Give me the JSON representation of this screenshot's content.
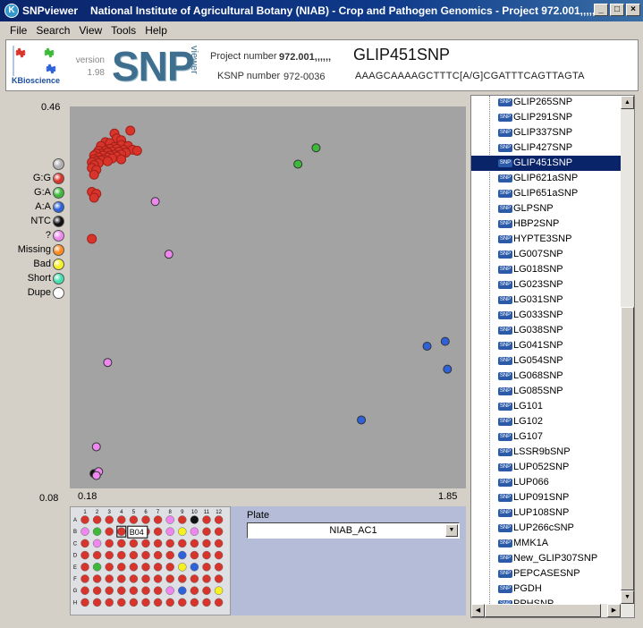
{
  "window": {
    "app_name": "SNPviewer",
    "title": "National Institute of Agricultural Botany (NIAB) - Crop and Pathogen Genomics - Project 972.001,,,,,,"
  },
  "menu": [
    "File",
    "Search",
    "View",
    "Tools",
    "Help"
  ],
  "header": {
    "logo_text": "KBioscience",
    "version_label": "version",
    "version_value": "1.98",
    "brand_big": "SNP",
    "brand_small": "viewer",
    "project_label": "Project number",
    "project_value": "972.001,,,,,,",
    "ksnp_label": "KSNP number",
    "ksnp_value": "972-0036",
    "snp_name": "GLIP451SNP",
    "sequence": "AAAGCAAAAGCTTTC[A/G]CGATTTCAGTTAGTA"
  },
  "legend": [
    {
      "label": "",
      "color": "#b0b0b0"
    },
    {
      "label": "G:G",
      "color": "#d9342b"
    },
    {
      "label": "G:A",
      "color": "#3db83a"
    },
    {
      "label": "A:A",
      "color": "#2f62d8"
    },
    {
      "label": "NTC",
      "color": "#111111"
    },
    {
      "label": "?",
      "color": "#ee88ee"
    },
    {
      "label": "Missing",
      "color": "#ff8a1e"
    },
    {
      "label": "Bad",
      "color": "#f5f021"
    },
    {
      "label": "Short",
      "color": "#44e0b0"
    },
    {
      "label": "Dupe",
      "color": "#ffffff"
    }
  ],
  "chart_data": {
    "type": "scatter",
    "xlim": [
      0.18,
      1.85
    ],
    "ylim": [
      0.08,
      0.46
    ],
    "x_min_label": "0.18",
    "x_max_label": "1.85",
    "y_max_label": "0.46",
    "y_min_label": "0.08",
    "series": [
      {
        "name": "G:G",
        "color": "#d9342b",
        "points": [
          [
            0.4,
            0.446
          ],
          [
            0.33,
            0.443
          ],
          [
            0.34,
            0.438
          ],
          [
            0.36,
            0.436
          ],
          [
            0.29,
            0.434
          ],
          [
            0.31,
            0.433
          ],
          [
            0.36,
            0.431
          ],
          [
            0.39,
            0.43
          ],
          [
            0.27,
            0.43
          ],
          [
            0.33,
            0.429
          ],
          [
            0.31,
            0.427
          ],
          [
            0.34,
            0.427
          ],
          [
            0.37,
            0.426
          ],
          [
            0.41,
            0.426
          ],
          [
            0.29,
            0.425
          ],
          [
            0.26,
            0.425
          ],
          [
            0.43,
            0.425
          ],
          [
            0.32,
            0.424
          ],
          [
            0.35,
            0.424
          ],
          [
            0.3,
            0.423
          ],
          [
            0.38,
            0.423
          ],
          [
            0.27,
            0.422
          ],
          [
            0.25,
            0.422
          ],
          [
            0.33,
            0.421
          ],
          [
            0.36,
            0.421
          ],
          [
            0.31,
            0.42
          ],
          [
            0.28,
            0.42
          ],
          [
            0.24,
            0.42
          ],
          [
            0.34,
            0.419
          ],
          [
            0.3,
            0.418
          ],
          [
            0.26,
            0.418
          ],
          [
            0.32,
            0.417
          ],
          [
            0.28,
            0.416
          ],
          [
            0.24,
            0.416
          ],
          [
            0.36,
            0.416
          ],
          [
            0.27,
            0.415
          ],
          [
            0.25,
            0.414
          ],
          [
            0.3,
            0.414
          ],
          [
            0.23,
            0.413
          ],
          [
            0.26,
            0.412
          ],
          [
            0.24,
            0.41
          ],
          [
            0.23,
            0.407
          ],
          [
            0.25,
            0.405
          ],
          [
            0.24,
            0.4
          ],
          [
            0.23,
            0.382
          ],
          [
            0.25,
            0.38
          ],
          [
            0.24,
            0.376
          ],
          [
            0.23,
            0.333
          ]
        ]
      },
      {
        "name": "G:A",
        "color": "#3db83a",
        "points": [
          [
            1.22,
            0.428
          ],
          [
            1.14,
            0.411
          ]
        ]
      },
      {
        "name": "A:A",
        "color": "#2f62d8",
        "points": [
          [
            1.79,
            0.226
          ],
          [
            1.71,
            0.221
          ],
          [
            1.8,
            0.197
          ],
          [
            1.42,
            0.144
          ]
        ]
      },
      {
        "name": "NTC",
        "color": "#111111",
        "points": [
          [
            0.24,
            0.088
          ]
        ]
      },
      {
        "name": "?",
        "color": "#ee88ee",
        "points": [
          [
            0.51,
            0.372
          ],
          [
            0.57,
            0.317
          ],
          [
            0.3,
            0.204
          ],
          [
            0.25,
            0.116
          ],
          [
            0.26,
            0.09
          ],
          [
            0.25,
            0.086
          ]
        ]
      }
    ]
  },
  "plate": {
    "columns": [
      "1",
      "2",
      "3",
      "4",
      "5",
      "6",
      "7",
      "8",
      "9",
      "10",
      "11",
      "12"
    ],
    "rows": [
      "A",
      "B",
      "C",
      "D",
      "E",
      "F",
      "G",
      "H"
    ],
    "tooltip": "B04",
    "wells": [
      [
        "r",
        "r",
        "r",
        "r",
        "r",
        "r",
        "r",
        "p",
        "r",
        "k",
        "r",
        "r"
      ],
      [
        "p",
        "g",
        "r",
        "r",
        "r",
        "r",
        "r",
        "p",
        "y",
        "p",
        "r",
        "r"
      ],
      [
        "r",
        "p",
        "r",
        "r",
        "r",
        "r",
        "r",
        "r",
        "r",
        "r",
        "r",
        "r"
      ],
      [
        "r",
        "r",
        "r",
        "r",
        "r",
        "r",
        "r",
        "r",
        "b",
        "r",
        "r",
        "r"
      ],
      [
        "r",
        "g",
        "r",
        "r",
        "r",
        "r",
        "r",
        "r",
        "y",
        "b",
        "r",
        "r"
      ],
      [
        "r",
        "r",
        "r",
        "r",
        "r",
        "r",
        "r",
        "r",
        "r",
        "r",
        "r",
        "r"
      ],
      [
        "r",
        "r",
        "r",
        "r",
        "r",
        "r",
        "r",
        "p",
        "b",
        "r",
        "r",
        "y"
      ],
      [
        "r",
        "r",
        "r",
        "r",
        "r",
        "r",
        "r",
        "r",
        "r",
        "r",
        "r",
        "r"
      ]
    ],
    "well_colors": {
      "r": "#d9342b",
      "g": "#3db83a",
      "b": "#2f62d8",
      "k": "#111111",
      "p": "#ee88ee",
      "y": "#f5f021"
    },
    "label": "Plate",
    "selected": "NIAB_AC1"
  },
  "snp_list": [
    "GLIP265SNP",
    "GLIP291SNP",
    "GLIP337SNP",
    "GLIP427SNP",
    "GLIP451SNP",
    "GLIP621aSNP",
    "GLIP651aSNP",
    "GLPSNP",
    "HBP2SNP",
    "HYPTE3SNP",
    "LG007SNP",
    "LG018SNP",
    "LG023SNP",
    "LG031SNP",
    "LG033SNP",
    "LG038SNP",
    "LG041SNP",
    "LG054SNP",
    "LG068SNP",
    "LG085SNP",
    "LG101",
    "LG102",
    "LG107",
    "LSSR9bSNP",
    "LUP052SNP",
    "LUP066",
    "LUP091SNP",
    "LUP108SNP",
    "LUP266cSNP",
    "MMK1A",
    "New_GLIP307SNP",
    "PEPCASESNP",
    "PGDH",
    "PPHSNP"
  ],
  "snp_list_selected_index": 4
}
